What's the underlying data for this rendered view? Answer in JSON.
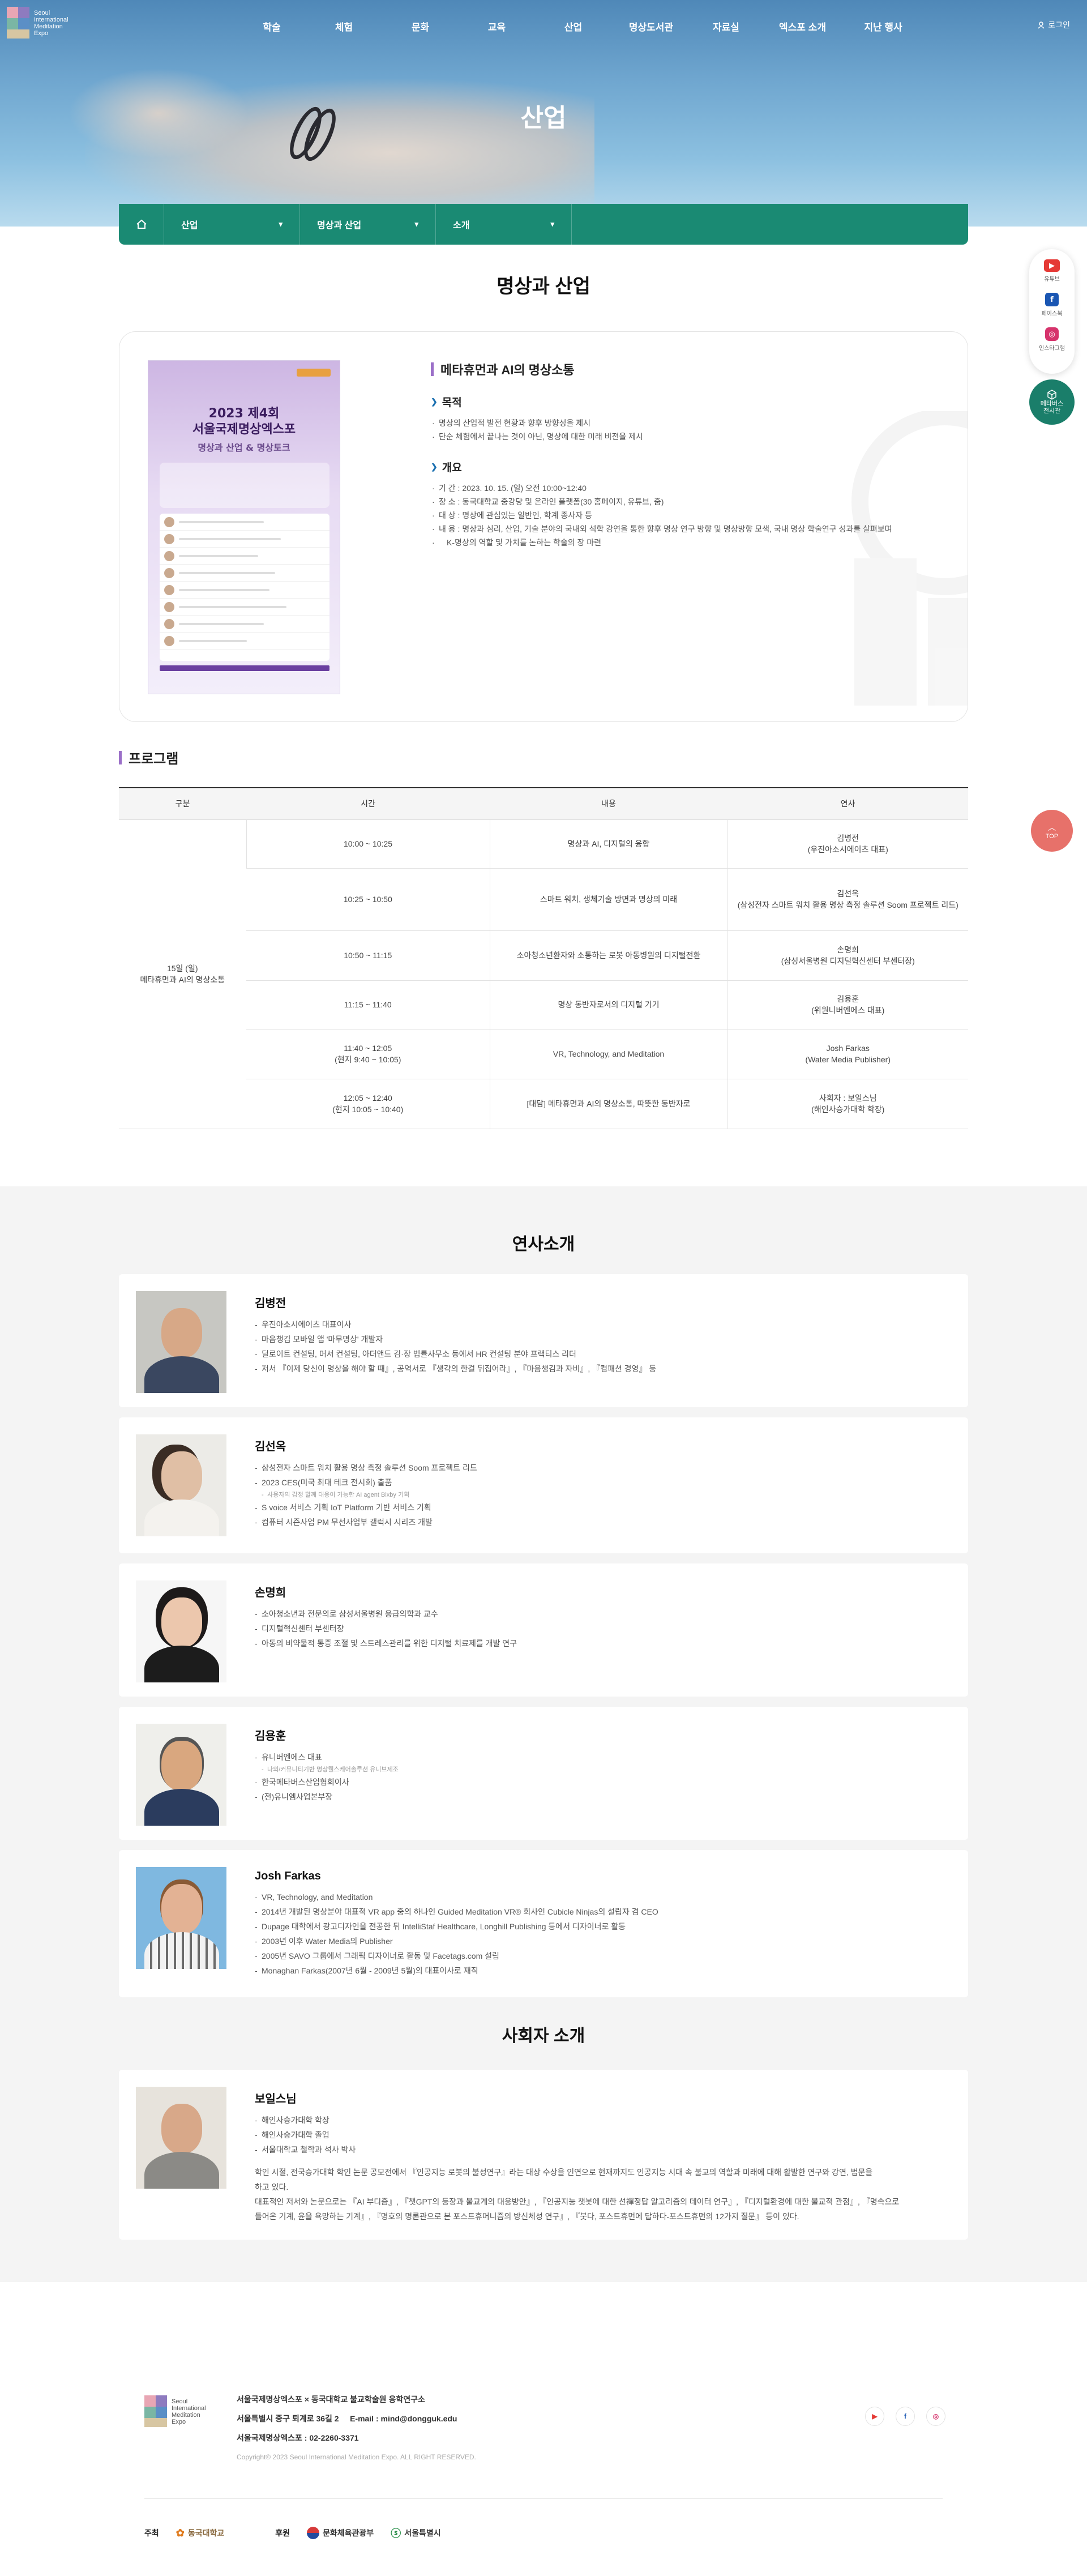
{
  "header": {
    "logo_text": [
      "Seoul",
      "International",
      "Meditation",
      "Expo"
    ],
    "nav": [
      "학술",
      "체험",
      "문화",
      "교육",
      "산업",
      "명상도서관",
      "자료실",
      "엑스포 소개",
      "지난 행사"
    ],
    "login": "로그인",
    "hero_title": "산업"
  },
  "breadcrumb": {
    "items": [
      "산업",
      "명상과 산업",
      "소개"
    ]
  },
  "quick_menu": {
    "items": [
      {
        "label": "유튜브",
        "icon": "youtube-icon",
        "color": "#e53935"
      },
      {
        "label": "페이스북",
        "icon": "facebook-icon",
        "color": "#1a56b3"
      },
      {
        "label": "인스타그램",
        "icon": "instagram-icon",
        "color": "#d6336c"
      }
    ],
    "meta": [
      "메타버스",
      "전시관"
    ],
    "top": "TOP"
  },
  "page_title": "명상과 산업",
  "intro": {
    "heading": "메타휴먼과 AI의 명상소통",
    "purpose_title": "목적",
    "purpose": [
      "명상의 산업적 발전 현황과 향후 방향성을 제시",
      "단순 체험에서 끝나는 것이 아닌, 명상에 대한 미래 비전을 제시"
    ],
    "overview_title": "개요",
    "overview": [
      "기 간 : 2023. 10. 15. (일) 오전 10:00~12:40",
      "장 소 : 동국대학교 중강당 및 온라인 플랫폼(30 홈페이지, 유튜브, 줌)",
      "대 상 : 명상에 관심있는 일반인, 학계 종사자 등",
      "내 용 : 명상과 심리, 산업, 기술 분야의 국내외 석학 강연을 통한 향후 명상 연구 방향 및 명상방향 모색, 국내 명상 학술연구 성과를 살펴보며",
      "K-명상의 역할 및 가치를 논하는 학술의 장 마련"
    ],
    "poster": {
      "title": "2023 제4회\n서울국제명상엑스포",
      "subtitle": "명상과 산업 & 명상토크"
    }
  },
  "program": {
    "title": "프로그램",
    "headers": [
      "구분",
      "시간",
      "내용",
      "연사"
    ],
    "day_label": "15일 (일)\n메타휴먼과 AI의 명상소통",
    "rows": [
      {
        "time": "10:00 ~ 10:25",
        "content": "명상과 AI, 디지털의 융합",
        "speaker": "김병전\n(우진아소시에이츠 대표)"
      },
      {
        "time": "10:25 ~ 10:50",
        "content": "스마트 워치, 생체기술 방면과 명상의 미래",
        "speaker": "김선옥\n(삼성전자 스마트 워치 활용 명상 측정 솔루션 Soom 프로젝트 리드)"
      },
      {
        "time": "10:50 ~ 11:15",
        "content": "소아청소년환자와 소통하는 로봇 아동병원의 디지털전환",
        "speaker": "손명희\n(삼성서울병원 디지털혁신센터 부센터장)"
      },
      {
        "time": "11:15 ~ 11:40",
        "content": "명상 동반자로서의 디지털 기기",
        "speaker": "김용훈\n(위원니버엔에스 대표)"
      },
      {
        "time": "11:40 ~ 12:05\n(현지 9:40 ~ 10:05)",
        "content": "VR, Technology, and Meditation",
        "speaker": "Josh Farkas\n(Water Media Publisher)"
      },
      {
        "time": "12:05 ~ 12:40\n(현지 10:05 ~ 10:40)",
        "content": "[대담] 메타휴먼과 AI의 명상소통, 따뜻한 동반자로",
        "speaker": "사회자 : 보일스님\n(해인사승가대학 학장)"
      }
    ]
  },
  "speakers_title": "연사소개",
  "speakers": [
    {
      "name": "김병전",
      "lines": [
        "우진아소시에이츠 대표이사",
        "마음챙김 모바일 앱 '마무명상' 개발자",
        "딜로이트 컨설팅, 머서 컨설팅, 아더앤드 김·장 법률사무소 등에서 HR 컨설팅 분야 프랙티스 리더",
        "저서 『이제 당신이 명상을 해야 할 때』, 공역서로 『생각의 한걸 뒤집어라』, 『마음챙김과 자비』, 『컴패션 경영』 등"
      ]
    },
    {
      "name": "김선옥",
      "lines": [
        "삼성전자 스마트 워치 활용 명상 측정 솔루션 Soom 프로젝트 리드",
        "2023 CES(미국 최대 테크 전시회) 출품",
        "사용자의 감정 할께 대응이 가능한 AI agent Bixby 기획",
        "S voice 서비스 기획 IoT Platform 기반 서비스 기획",
        "컴퓨터 시즌사업 PM 무선사업부 갤럭시 시리즈 개발"
      ],
      "subnote_index": 2
    },
    {
      "name": "손명희",
      "lines": [
        "소아청소년과 전문의로 삼성서울병원 응급의학과 교수",
        "디지털혁신센터 부센터장",
        "아동의 비약물적 통증 조절 및 스트레스관리를 위한 디지털 치료제를 개발 연구"
      ]
    },
    {
      "name": "김용훈",
      "lines": [
        "유니버엔에스 대표",
        "나의/커뮤니티기반 명상웰스케어솔루션 유니브제조",
        "한국메타버스산업협회이사",
        "(전)유니엠사업본부장"
      ],
      "subnote_index": 1
    },
    {
      "name": "Josh Farkas",
      "lines": [
        "VR, Technology, and Meditation",
        "2014년 개발된 명상분야 대표적 VR app 중의 하나인 Guided Meditation VR® 회사인 Cubicle Ninjas의 설립자 겸 CEO",
        "Dupage 대학에서 광고디자인을 전공한 뒤 IntelliStaf Healthcare, Longhill Publishing 등에서 디자이너로 활동",
        "2003년 이후 Water Media의 Publisher",
        "2005년 SAVO 그룹에서 그래픽 디자이너로 활동 및 Facetags.com 설립",
        "Monaghan Farkas(2007년 6월 - 2009년 5월)의 대표이사로 재직"
      ]
    }
  ],
  "moderator_title": "사회자 소개",
  "moderator": {
    "name": "보일스님",
    "lines": [
      "해인사승가대학 학장",
      "해인사승가대학 졸업",
      "서울대학교 철학과 석사 박사"
    ],
    "paragraph": [
      "학인 시절, 전국승가대학 학인 논문 공모전에서 『인공지능 로봇의 불성연구』라는 대상 수상을 인연으로 현재까지도 인공지능 시대 속 불교의 역할과 미래에 대해 활발한 연구와 강연, 법문을",
      "하고 있다.",
      "대표적인 저서와 논문으로는 『AI 부디즘』, 『챗GPT의 등장과 불교계의 대응방안』, 『인공지능 챗봇에 대한 선禪정답 알고리즘의 데이터 연구』, 『디지털환경에 대한 불교적 관점』, 『명속으로",
      "들어온 기계, 윤을 욕망하는 기계』, 『명호의 명론관으로 본 포스트휴머니즘의 방신체성 연구』, 『붓다, 포스트휴먼에 답하다-포스트휴먼의 12가지 질문』 등이 있다."
    ]
  },
  "footer": {
    "org_line": "서울국제명상엑스포 × 동국대학교 불교학술원 응학연구소",
    "address_line": "서울특별시 중구 퇴계로 36길 2",
    "email_line": "E-mail : mind@dongguk.edu",
    "phone_line": "서울국제명상엑스포 : 02-2260-3371",
    "copyright": "Copyright© 2023 Seoul International Meditation Expo. ALL RIGHT RESERVED.",
    "host_label": "주최",
    "host": "동국대학교",
    "sponsor_label": "후원",
    "sponsors": [
      "문화체육관광부",
      "서울특별시"
    ],
    "social": [
      "youtube-icon",
      "facebook-icon",
      "instagram-icon"
    ]
  }
}
